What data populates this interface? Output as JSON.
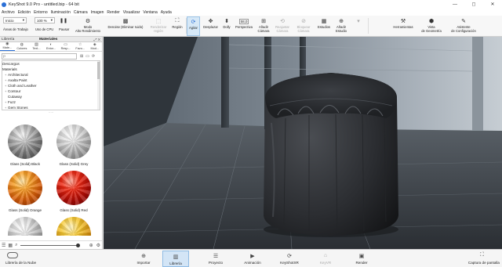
{
  "window": {
    "title": "KeyShot 9.0 Pro  -  untitled.bip  -  64 bit",
    "controls": {
      "minimize": "—",
      "maximize": "◻",
      "close": "✕"
    }
  },
  "menu": {
    "items": [
      "Archivo",
      "Edición",
      "Entorno",
      "Iluminación",
      "Cámara",
      "Imagen",
      "Render",
      "Visualizar",
      "Ventana",
      "Ayuda"
    ]
  },
  "toolbar": {
    "workspace_select": "Inicio",
    "zoom_select": "100 %",
    "cores_value": "58,0",
    "small_labels": {
      "workspace": "Áreas de Trabajo",
      "cpu": "Uso de CPU",
      "pause": "Pausar"
    },
    "buttons": [
      {
        "id": "performance",
        "label": "Modo\nAlto Rendimiento",
        "icon": "gauge-icon",
        "glyph": "⚙",
        "disabled": false,
        "active": false
      },
      {
        "id": "denoise",
        "label": "Denoise (Eliminar ruido)",
        "icon": "denoise-icon",
        "glyph": "▩",
        "disabled": false,
        "active": false
      },
      {
        "id": "render-region",
        "label": "Renderizar\nregión",
        "icon": "region-icon",
        "glyph": "⬚",
        "disabled": true,
        "active": false
      },
      {
        "id": "region",
        "label": "Región",
        "icon": "region-select-icon",
        "glyph": "⛶",
        "disabled": false,
        "active": false
      },
      {
        "id": "tumble",
        "label": "Agitar",
        "icon": "tumble-icon",
        "glyph": "⟳",
        "disabled": false,
        "active": true
      },
      {
        "id": "pan",
        "label": "Desplazar",
        "icon": "pan-icon",
        "glyph": "✥",
        "disabled": false,
        "active": false
      },
      {
        "id": "dolly",
        "label": "Dolly",
        "icon": "dolly-icon",
        "glyph": "⬍",
        "disabled": false,
        "active": false
      },
      {
        "id": "perspective",
        "label": "Perspectiva",
        "icon": "perspective-icon",
        "glyph": "◫",
        "disabled": false,
        "active": false
      },
      {
        "id": "add-camera",
        "label": "Añadir\nCámara",
        "icon": "add-camera-icon",
        "glyph": "⊞",
        "disabled": false,
        "active": false
      },
      {
        "id": "reset-camera",
        "label": "Reajustar\nCámara",
        "icon": "reset-camera-icon",
        "glyph": "⟲",
        "disabled": true,
        "active": false
      },
      {
        "id": "lock-camera",
        "label": "Bloquear\nCámara",
        "icon": "lock-camera-icon",
        "glyph": "🔒",
        "disabled": true,
        "active": false
      },
      {
        "id": "studios",
        "label": "Estudios",
        "icon": "studios-icon",
        "glyph": "▦",
        "disabled": false,
        "active": false
      },
      {
        "id": "add-studio",
        "label": "Añadir\nEstudio",
        "icon": "add-studio-icon",
        "glyph": "⊕",
        "disabled": false,
        "active": false
      },
      {
        "id": "tools",
        "label": "Herramientas",
        "icon": "tools-icon",
        "glyph": "⚒",
        "disabled": false,
        "active": false
      },
      {
        "id": "geometry-view",
        "label": "Vista\nde Geometría",
        "icon": "geometry-view-icon",
        "glyph": "⬢",
        "disabled": false,
        "active": false
      },
      {
        "id": "config-wizard",
        "label": "Asistente\nde Configuración",
        "icon": "wizard-icon",
        "glyph": "✎",
        "disabled": false,
        "active": false
      }
    ]
  },
  "library": {
    "tab_left": "Librería",
    "tab_right": "Materiales",
    "panel_controls": "⤢  ✕",
    "tabs": [
      {
        "label": "Mate...",
        "icon": "materials-icon",
        "glyph": "◉",
        "active": true
      },
      {
        "label": "Colores",
        "icon": "colors-icon",
        "glyph": "◍",
        "active": false
      },
      {
        "label": "Text...",
        "icon": "textures-icon",
        "glyph": "▧",
        "active": false
      },
      {
        "label": "Entor...",
        "icon": "environments-icon",
        "glyph": "◐",
        "active": false
      },
      {
        "label": "Resp...",
        "icon": "backplates-icon",
        "glyph": "▭",
        "active": false
      },
      {
        "label": "Favo...",
        "icon": "favorites-icon",
        "glyph": "☆",
        "active": false
      },
      {
        "label": "Mod...",
        "icon": "models-icon",
        "glyph": "◈",
        "active": false
      }
    ],
    "search_placeholder": "ρ",
    "tree": [
      {
        "label": "Descargas",
        "child": false,
        "italic": true
      },
      {
        "label": "Materials",
        "child": false,
        "italic": false
      },
      {
        "label": "Architectural",
        "child": true
      },
      {
        "label": "Axalta Paint",
        "child": true
      },
      {
        "label": "Cloth and Leather",
        "child": true
      },
      {
        "label": "Contour",
        "child": true
      },
      {
        "label": "Cutaway",
        "child": true
      },
      {
        "label": "Fuzz",
        "child": true
      },
      {
        "label": "Gem Stones",
        "child": true
      }
    ],
    "thumbnails": [
      {
        "caption": "Glass (Solid) Black",
        "swatch": "black"
      },
      {
        "caption": "Glass (Solid) Grey",
        "swatch": "grey"
      },
      {
        "caption": "Glass (Solid) Orange",
        "swatch": "orange"
      },
      {
        "caption": "Glass (Solid) Red",
        "swatch": "red"
      },
      {
        "caption": "",
        "swatch": "grey"
      },
      {
        "caption": "",
        "swatch": "yellow"
      }
    ]
  },
  "bottom": {
    "cloud_library": "Librería de la Nube",
    "buttons": [
      {
        "id": "import",
        "label": "Importar",
        "icon": "import-icon",
        "glyph": "⊕",
        "active": false,
        "disabled": false
      },
      {
        "id": "library",
        "label": "Librería",
        "icon": "library-book-icon",
        "glyph": "📖",
        "active": true,
        "disabled": false
      },
      {
        "id": "project",
        "label": "Proyecto",
        "icon": "project-icon",
        "glyph": "☰",
        "active": false,
        "disabled": false
      },
      {
        "id": "animation",
        "label": "Animación",
        "icon": "animation-icon",
        "glyph": "▶",
        "active": false,
        "disabled": false
      },
      {
        "id": "keyshotxr",
        "label": "KeyShotXR",
        "icon": "keyshotxr-icon",
        "glyph": "⟳",
        "active": false,
        "disabled": false
      },
      {
        "id": "keyvr",
        "label": "KeyVR",
        "icon": "keyvr-icon",
        "glyph": "⌂",
        "active": false,
        "disabled": true
      },
      {
        "id": "render",
        "label": "Render",
        "icon": "render-icon",
        "glyph": "▣",
        "active": false,
        "disabled": false
      }
    ],
    "screenshot": "Captura de pantalla"
  },
  "colors": {
    "accent": "#2a6fd6",
    "active_bg": "#d3e5f6"
  }
}
